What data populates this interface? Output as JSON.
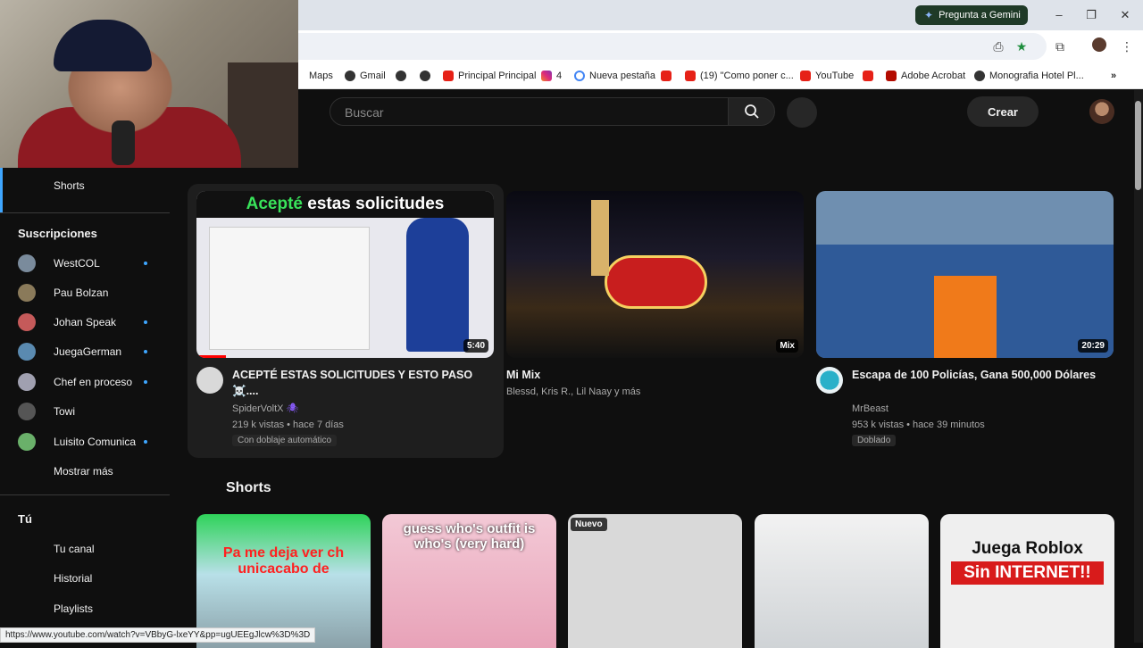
{
  "browser": {
    "gemini_label": "Pregunta a Gemini",
    "bookmarks": [
      {
        "label": "Maps",
        "icon": "maps-icon"
      },
      {
        "label": "Gmail",
        "icon": "globe-icon"
      },
      {
        "label": "",
        "icon": "globe-icon"
      },
      {
        "label": "",
        "icon": "globe-icon"
      },
      {
        "label": "Principal Principal",
        "icon": "youtube-icon"
      },
      {
        "label": "4",
        "icon": "instagram-icon"
      },
      {
        "label": "Nueva pestaña",
        "icon": "google-icon"
      },
      {
        "label": "",
        "icon": "youtube-icon"
      },
      {
        "label": "(19) \"Como poner c...",
        "icon": "youtube-icon"
      },
      {
        "label": "YouTube",
        "icon": "youtube-icon"
      },
      {
        "label": "",
        "icon": "youtube-icon"
      },
      {
        "label": "Adobe Acrobat",
        "icon": "pdf-icon"
      },
      {
        "label": "Monografia Hotel Pl...",
        "icon": "globe-icon"
      }
    ],
    "status_url": "https://www.youtube.com/watch?v=VBbyG-lxeYY&pp=ugUEEgJlcw%3D%3D"
  },
  "youtube": {
    "search_placeholder": "Buscar",
    "create_label": "Crear",
    "sidebar": {
      "shorts_label": "Shorts",
      "subscriptions_heading": "Suscripciones",
      "subscriptions": [
        {
          "name": "WestCOL",
          "dot": true,
          "color": "#7a8b9c"
        },
        {
          "name": "Pau Bolzan",
          "dot": false,
          "color": "#8a7a5a"
        },
        {
          "name": "Johan Speak",
          "dot": true,
          "color": "#c55a5a"
        },
        {
          "name": "JuegaGerman",
          "dot": true,
          "color": "#5a8ab0"
        },
        {
          "name": "Chef en proceso",
          "dot": true,
          "color": "#a0a0b0"
        },
        {
          "name": "Towi",
          "dot": false,
          "color": "#555555"
        },
        {
          "name": "Luisito Comunica",
          "dot": true,
          "color": "#6ab06a"
        }
      ],
      "show_more": "Mostrar más",
      "you_heading": "Tú",
      "you_items": [
        "Tu canal",
        "Historial",
        "Playlists"
      ]
    },
    "videos": [
      {
        "thumb_text_green": "Acepté",
        "thumb_text_white": "estas solicitudes",
        "duration": "5:40",
        "title": "ACEPTÉ ESTAS SOLICITUDES Y ESTO PASO ☠️....",
        "channel": "SpiderVoltX",
        "channel_mark": "🕷",
        "meta": "219 k vistas • hace 7 días",
        "badge": "Con doblaje automático",
        "watched_fraction": 0.1
      },
      {
        "duration": "Mix",
        "title": "Mi Mix",
        "channel": "Blessd, Kris R., Lil Naay y más"
      },
      {
        "duration": "20:29",
        "title": "Escapa de 100 Policías, Gana 500,000 Dólares",
        "channel": "MrBeast",
        "meta": "953 k vistas • hace 39 minutos",
        "badge": "Doblado"
      }
    ],
    "shorts_heading": "Shorts",
    "shorts": [
      {
        "caption": "Pa me deja ver ch unicacabo de"
      },
      {
        "caption": "guess who's outfit is who's (very hard)"
      },
      {
        "badge": "Nuevo",
        "caption": ""
      },
      {
        "caption": ""
      },
      {
        "caption_line1": "Juega Roblox",
        "caption_line2": "Sin INTERNET!!"
      }
    ]
  }
}
